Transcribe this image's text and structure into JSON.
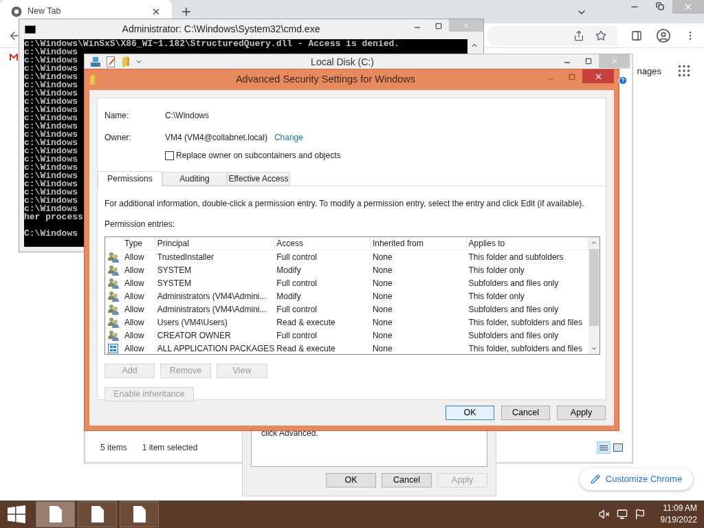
{
  "browser": {
    "tab_title": "New Tab",
    "page_text": "nages",
    "customize_button": "Customize Chrome"
  },
  "cmd_window": {
    "title": "Administrator: C:\\Windows\\System32\\cmd.exe",
    "lines": [
      "c:\\Windows\\WinSxS\\X86_WI~1.182\\StructuredQuery.dll - Access is denied.",
      "c:\\Windows",
      "c:\\Windows",
      "c:\\Windows",
      "c:\\Windows",
      "c:\\Windows",
      "c:\\Windows",
      "c:\\Windows",
      "c:\\Windows",
      "c:\\Windows",
      "c:\\Windows",
      "c:\\Windows",
      "c:\\Windows",
      "c:\\Windows",
      "c:\\Windows",
      "c:\\Windows",
      "c:\\Windows",
      "c:\\Windows",
      "c:\\Windows",
      "c:\\Windows",
      "c:\\Windows",
      "her process",
      "C:\\Windows"
    ]
  },
  "explorer_window": {
    "title": "Local Disk (C:)",
    "status_items": "5 items",
    "status_selected": "1 item selected"
  },
  "properties_dialog": {
    "text": "click Advanced.",
    "buttons": [
      {
        "label": "OK",
        "disabled": false
      },
      {
        "label": "Cancel",
        "disabled": false
      },
      {
        "label": "Apply",
        "disabled": true
      }
    ]
  },
  "security_dialog": {
    "title": "Advanced Security Settings for Windows",
    "name_label": "Name:",
    "name_value": "C:\\Windows",
    "owner_label": "Owner:",
    "owner_value": "VM4 (VM4@collabnet.local)",
    "change_link": "Change",
    "replace_owner": {
      "label": "Replace owner on subcontainers and objects",
      "checked": false
    },
    "tabs": [
      {
        "label": "Permissions",
        "selected": true
      },
      {
        "label": "Auditing",
        "selected": false
      },
      {
        "label": "Effective Access",
        "selected": false
      }
    ],
    "info": "For additional information, double-click a permission entry. To modify a permission entry, select the entry and click Edit (if available).",
    "entries_label": "Permission entries:",
    "table": {
      "columns": [
        "Type",
        "Principal",
        "Access",
        "Inherited from",
        "Applies to"
      ],
      "rows": [
        {
          "kind": "group",
          "cells": [
            "Allow",
            "TrustedInstaller",
            "Full control",
            "None",
            "This folder and subfolders"
          ]
        },
        {
          "kind": "group",
          "cells": [
            "Allow",
            "SYSTEM",
            "Modify",
            "None",
            "This folder only"
          ]
        },
        {
          "kind": "group",
          "cells": [
            "Allow",
            "SYSTEM",
            "Full control",
            "None",
            "Subfolders and files only"
          ]
        },
        {
          "kind": "group",
          "cells": [
            "Allow",
            "Administrators (VM4\\Admini...",
            "Modify",
            "None",
            "This folder only"
          ]
        },
        {
          "kind": "group",
          "cells": [
            "Allow",
            "Administrators (VM4\\Admini...",
            "Full control",
            "None",
            "Subfolders and files only"
          ]
        },
        {
          "kind": "group",
          "cells": [
            "Allow",
            "Users (VM4\\Users)",
            "Read & execute",
            "None",
            "This folder, subfolders and files"
          ]
        },
        {
          "kind": "group",
          "cells": [
            "Allow",
            "CREATOR OWNER",
            "Full control",
            "None",
            "Subfolders and files only"
          ]
        },
        {
          "kind": "package",
          "cells": [
            "Allow",
            "ALL APPLICATION PACKAGES",
            "Read & execute",
            "None",
            "This folder, subfolders and files"
          ]
        }
      ]
    },
    "entry_buttons": [
      {
        "label": "Add",
        "disabled": true
      },
      {
        "label": "Remove",
        "disabled": true
      },
      {
        "label": "View",
        "disabled": true
      }
    ],
    "inheritance_button": {
      "label": "Enable inheritance",
      "disabled": true
    },
    "buttons": [
      {
        "label": "OK",
        "disabled": false,
        "default": true
      },
      {
        "label": "Cancel",
        "disabled": false,
        "default": false
      },
      {
        "label": "Apply",
        "disabled": false,
        "default": false
      }
    ]
  },
  "taskbar": {
    "time": "11:09 AM",
    "date": "9/19/2022"
  }
}
